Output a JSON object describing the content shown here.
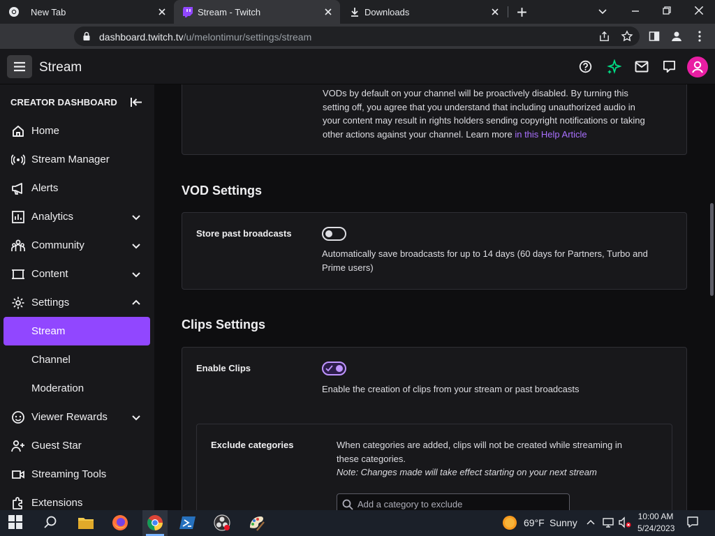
{
  "browser": {
    "tabs": [
      {
        "title": "New Tab",
        "icon": "chrome-icon",
        "active": false
      },
      {
        "title": "Stream - Twitch",
        "icon": "twitch-icon",
        "active": true
      },
      {
        "title": "Downloads",
        "icon": "download-icon",
        "active": false
      }
    ],
    "url_host": "dashboard.twitch.tv",
    "url_path": "/u/melontimur/settings/stream"
  },
  "header": {
    "title": "Stream"
  },
  "sidebar": {
    "heading": "CREATOR DASHBOARD",
    "items": [
      {
        "label": "Home",
        "icon": "home-icon",
        "chevron": "none"
      },
      {
        "label": "Stream Manager",
        "icon": "broadcast-icon",
        "chevron": "none"
      },
      {
        "label": "Alerts",
        "icon": "megaphone-icon",
        "chevron": "none"
      },
      {
        "label": "Analytics",
        "icon": "analytics-icon",
        "chevron": "down"
      },
      {
        "label": "Community",
        "icon": "community-icon",
        "chevron": "down"
      },
      {
        "label": "Content",
        "icon": "content-icon",
        "chevron": "down"
      },
      {
        "label": "Settings",
        "icon": "settings-icon",
        "chevron": "up"
      },
      {
        "label": "Stream",
        "icon": "",
        "chevron": "none",
        "active": true
      },
      {
        "label": "Channel",
        "icon": "",
        "chevron": "none"
      },
      {
        "label": "Moderation",
        "icon": "",
        "chevron": "none"
      },
      {
        "label": "Viewer Rewards",
        "icon": "rewards-icon",
        "chevron": "down"
      },
      {
        "label": "Guest Star",
        "icon": "guest-star-icon",
        "chevron": "none"
      },
      {
        "label": "Streaming Tools",
        "icon": "camera-icon",
        "chevron": "none"
      },
      {
        "label": "Extensions",
        "icon": "extensions-icon",
        "chevron": "none"
      }
    ]
  },
  "main": {
    "top_card": {
      "text_lines": [
        "VODs by default on your channel will be proactively disabled. By turning this",
        "setting off, you agree that you understand that including unauthorized audio in",
        "your content may result in rights holders sending copyright notifications or taking"
      ],
      "last_line": "other actions against your channel. Learn more ",
      "link": "in this Help Article"
    },
    "vod": {
      "title": "VOD Settings",
      "store_label": "Store past broadcasts",
      "store_on": false,
      "store_desc_1": "Automatically save broadcasts for up to 14 days (60 days for Partners, Turbo and",
      "store_desc_2": "Prime users)"
    },
    "clips": {
      "title": "Clips Settings",
      "enable_label": "Enable Clips",
      "enable_on": true,
      "enable_desc": "Enable the creation of clips from your stream or past broadcasts",
      "exclude_label": "Exclude categories",
      "exclude_desc_1": "When categories are added, clips will not be created while streaming in",
      "exclude_desc_2": "these categories.",
      "exclude_note": "Note: Changes made will take effect starting on your next stream",
      "search_placeholder": "Add a category to exclude"
    }
  },
  "taskbar": {
    "weather_temp": "69°F",
    "weather_cond": "Sunny",
    "time": "10:00 AM",
    "date": "5/24/2023"
  },
  "colors": {
    "accent": "#9147ff",
    "link": "#a970ff",
    "toggle_on": "#bf94ff"
  }
}
